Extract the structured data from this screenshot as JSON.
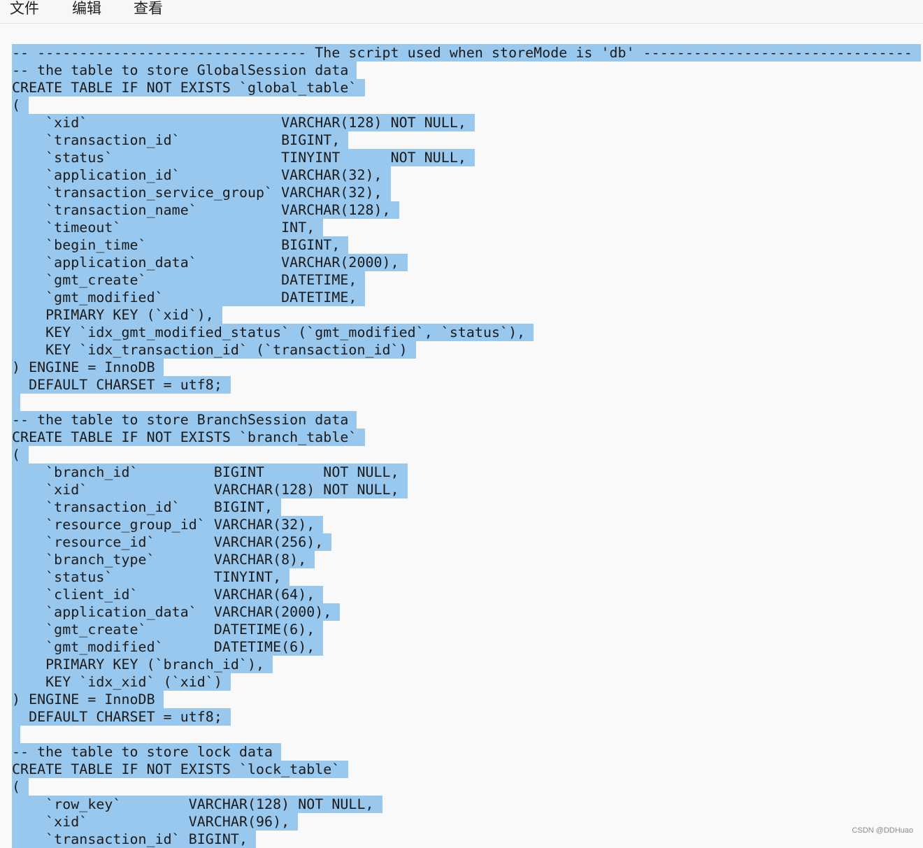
{
  "menu": {
    "items": [
      "文件",
      "编辑",
      "查看"
    ]
  },
  "editor": {
    "lines": [
      "-- -------------------------------- The script used when storeMode is 'db' --------------------------------",
      "-- the table to store GlobalSession data",
      "CREATE TABLE IF NOT EXISTS `global_table`",
      "(",
      "    `xid`                       VARCHAR(128) NOT NULL,",
      "    `transaction_id`            BIGINT,",
      "    `status`                    TINYINT      NOT NULL,",
      "    `application_id`            VARCHAR(32),",
      "    `transaction_service_group` VARCHAR(32),",
      "    `transaction_name`          VARCHAR(128),",
      "    `timeout`                   INT,",
      "    `begin_time`                BIGINT,",
      "    `application_data`          VARCHAR(2000),",
      "    `gmt_create`                DATETIME,",
      "    `gmt_modified`              DATETIME,",
      "    PRIMARY KEY (`xid`),",
      "    KEY `idx_gmt_modified_status` (`gmt_modified`, `status`),",
      "    KEY `idx_transaction_id` (`transaction_id`)",
      ") ENGINE = InnoDB",
      "  DEFAULT CHARSET = utf8;",
      "",
      "-- the table to store BranchSession data",
      "CREATE TABLE IF NOT EXISTS `branch_table`",
      "(",
      "    `branch_id`         BIGINT       NOT NULL,",
      "    `xid`               VARCHAR(128) NOT NULL,",
      "    `transaction_id`    BIGINT,",
      "    `resource_group_id` VARCHAR(32),",
      "    `resource_id`       VARCHAR(256),",
      "    `branch_type`       VARCHAR(8),",
      "    `status`            TINYINT,",
      "    `client_id`         VARCHAR(64),",
      "    `application_data`  VARCHAR(2000),",
      "    `gmt_create`        DATETIME(6),",
      "    `gmt_modified`      DATETIME(6),",
      "    PRIMARY KEY (`branch_id`),",
      "    KEY `idx_xid` (`xid`)",
      ") ENGINE = InnoDB",
      "  DEFAULT CHARSET = utf8;",
      "",
      "-- the table to store lock data",
      "CREATE TABLE IF NOT EXISTS `lock_table`",
      "(",
      "    `row_key`        VARCHAR(128) NOT NULL,",
      "    `xid`            VARCHAR(96),",
      "    `transaction_id` BIGINT,"
    ]
  },
  "watermark": "CSDN @DDHuao",
  "colors": {
    "selection": "#99c8ee",
    "background": "#f9f9f9",
    "text": "#1a1a1a"
  }
}
